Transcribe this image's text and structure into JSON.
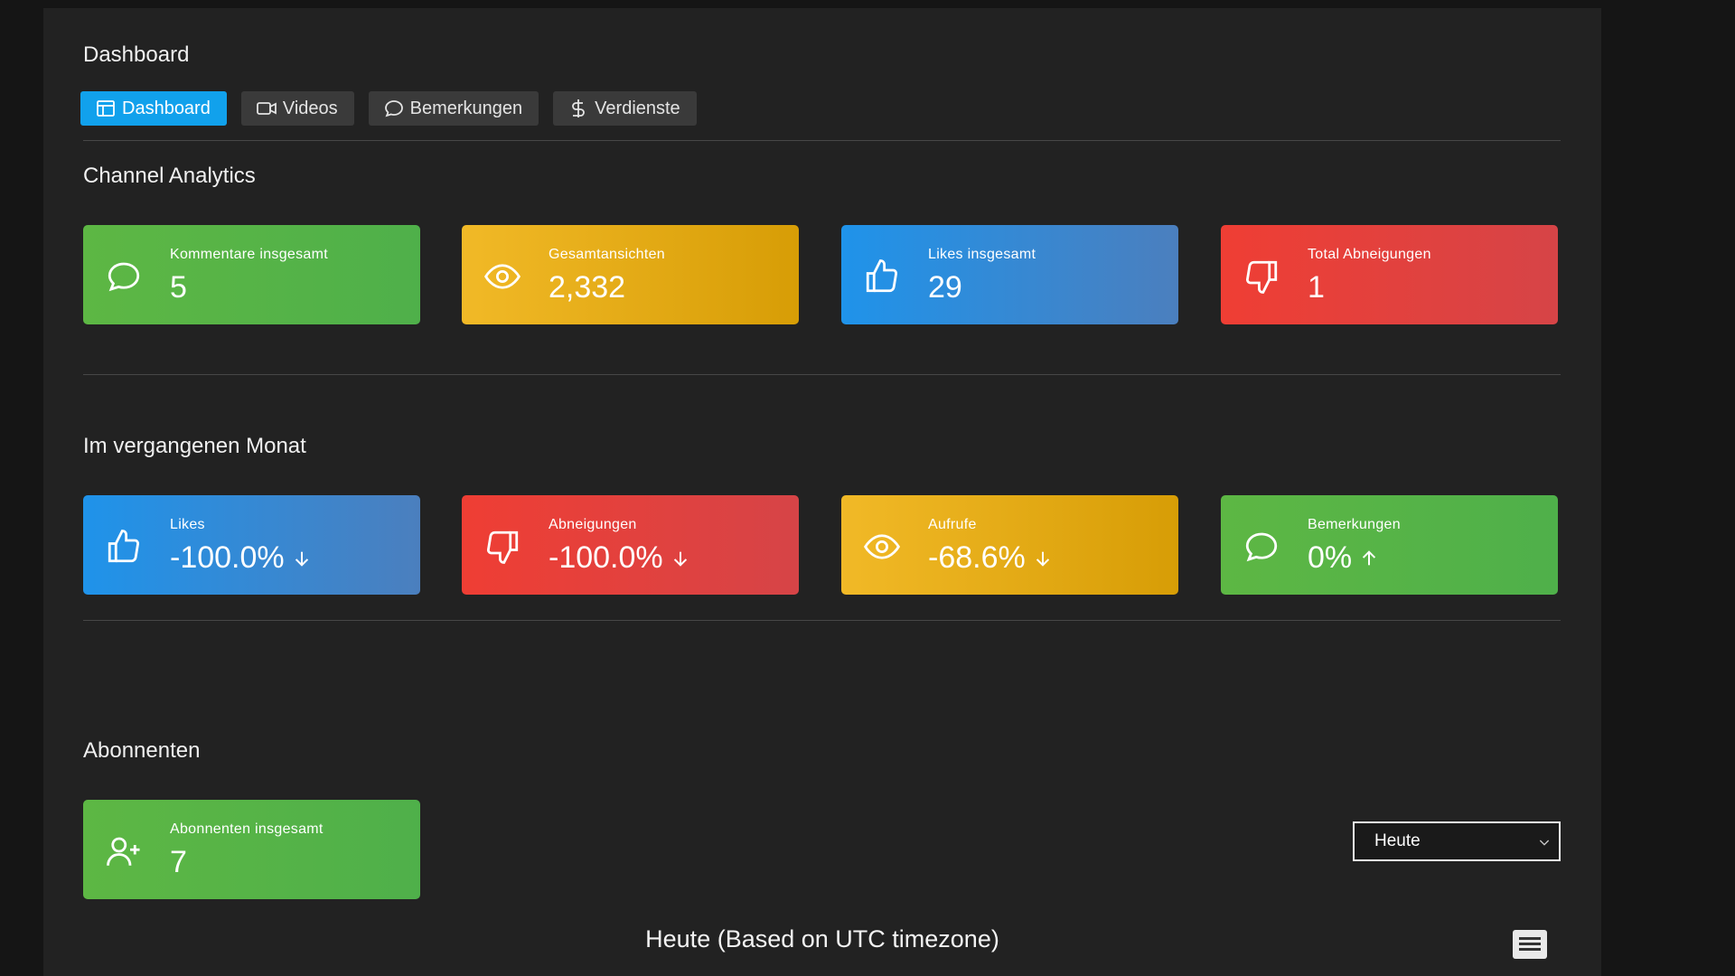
{
  "header": {
    "title": "Dashboard"
  },
  "tabs": [
    {
      "label": "Dashboard",
      "active": true,
      "icon": "layout-icon"
    },
    {
      "label": "Videos",
      "active": false,
      "icon": "video-camera-icon"
    },
    {
      "label": "Bemerkungen",
      "active": false,
      "icon": "comment-icon"
    },
    {
      "label": "Verdienste",
      "active": false,
      "icon": "dollar-icon"
    }
  ],
  "channel_analytics": {
    "title": "Channel Analytics",
    "cards": [
      {
        "label": "Kommentare insgesamt",
        "value": "5",
        "color": "#5db744",
        "icon": "comment-icon"
      },
      {
        "label": "Gesamtansichten",
        "value": "2,332",
        "color": "#f1b927",
        "icon": "eye-icon"
      },
      {
        "label": "Likes insgesamt",
        "value": "29",
        "color": "#1f93ea",
        "icon": "thumbs-up-icon"
      },
      {
        "label": "Total Abneigungen",
        "value": "1",
        "color": "#ef3e34",
        "icon": "thumbs-down-icon"
      }
    ]
  },
  "last_month": {
    "title": "Im vergangenen Monat",
    "cards": [
      {
        "label": "Likes",
        "value": "-100.0%",
        "trend": "down",
        "color": "#1f93ea",
        "icon": "thumbs-up-icon"
      },
      {
        "label": "Abneigungen",
        "value": "-100.0%",
        "trend": "down",
        "color": "#ef3e34",
        "icon": "thumbs-down-icon"
      },
      {
        "label": "Aufrufe",
        "value": "-68.6%",
        "trend": "down",
        "color": "#f1b927",
        "icon": "eye-icon"
      },
      {
        "label": "Bemerkungen",
        "value": "0%",
        "trend": "up",
        "color": "#5db744",
        "icon": "comment-icon"
      }
    ]
  },
  "subscribers": {
    "title": "Abonnenten",
    "card": {
      "label": "Abonnenten insgesamt",
      "value": "7",
      "color": "#5db744",
      "icon": "user-plus-icon"
    },
    "period_select": {
      "value": "Heute"
    },
    "chart_title": "Heute (Based on UTC timezone)"
  },
  "chart_menu": {
    "icon": "hamburger-menu-icon"
  }
}
